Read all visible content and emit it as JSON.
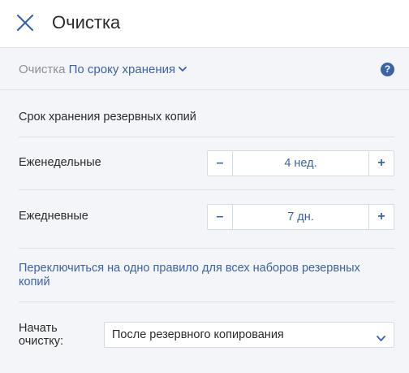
{
  "header": {
    "title": "Очистка",
    "close_icon": "close-icon"
  },
  "breadcrumb": {
    "static": "Очистка",
    "link": "По сроку хранения",
    "chevron_icon": "chevron-down-icon"
  },
  "help": {
    "glyph": "?",
    "icon": "help-icon"
  },
  "section": {
    "title": "Срок хранения резервных копий"
  },
  "rows": [
    {
      "label": "Еженедельные",
      "value": "4 нед.",
      "minus": "–",
      "plus": "+"
    },
    {
      "label": "Ежедневные",
      "value": "7 дн.",
      "minus": "–",
      "plus": "+"
    }
  ],
  "switch_link": "Переключиться на одно правило для всех наборов резервных копий",
  "start": {
    "label": "Начать очистку:",
    "selected": "После резервного копирования"
  },
  "colors": {
    "accent": "#3b63a8",
    "background": "#f3f5f8",
    "header_bg": "#ffffff",
    "divider": "#dde2e8",
    "text": "#2b2b2b",
    "muted": "#8a9099"
  }
}
